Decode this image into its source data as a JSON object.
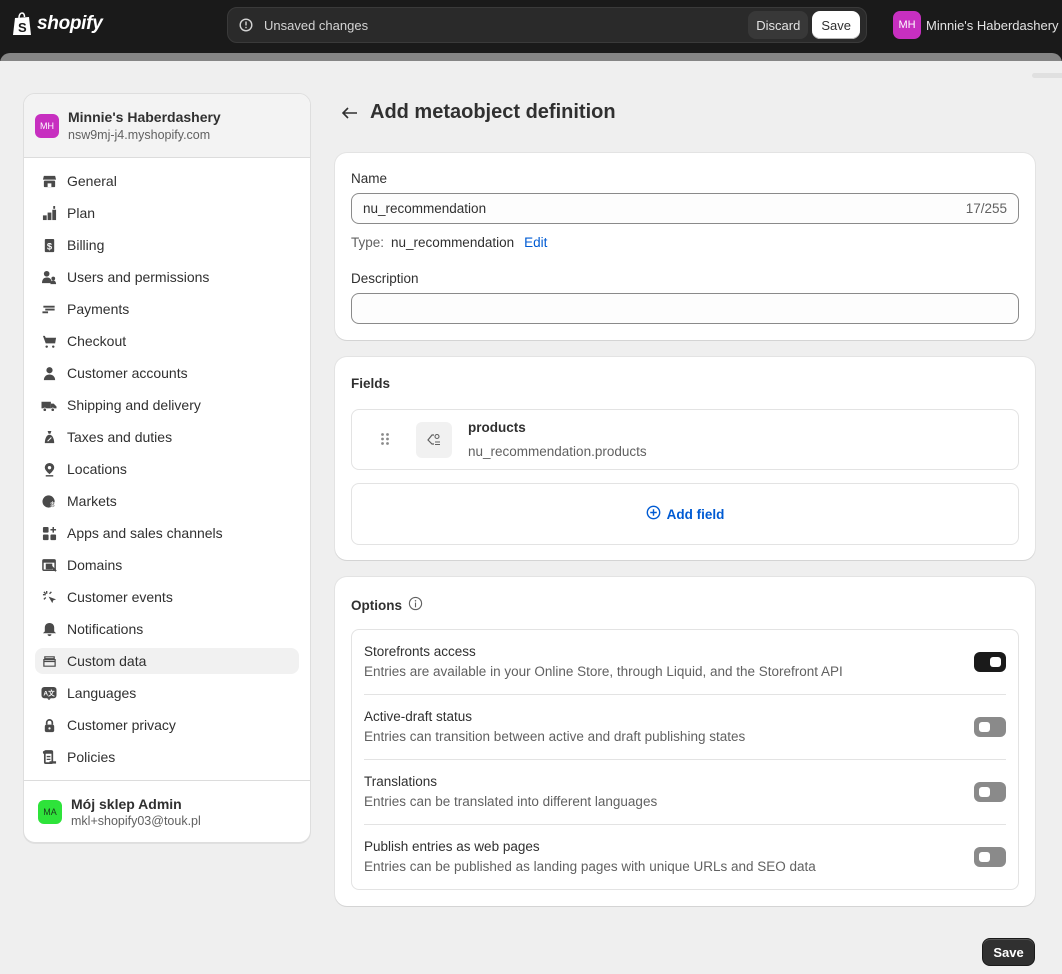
{
  "topbar": {
    "logo_text": "shopify",
    "unsaved_text": "Unsaved changes",
    "discard_label": "Discard",
    "save_label": "Save",
    "store_avatar": "MH",
    "store_name": "Minnie's Haberdashery"
  },
  "sidebar": {
    "store_avatar": "MH",
    "store_name": "Minnie's Haberdashery",
    "store_url": "nsw9mj-j4.myshopify.com",
    "items": [
      {
        "label": "General",
        "icon": "store-icon"
      },
      {
        "label": "Plan",
        "icon": "plan-icon"
      },
      {
        "label": "Billing",
        "icon": "billing-icon"
      },
      {
        "label": "Users and permissions",
        "icon": "users-icon"
      },
      {
        "label": "Payments",
        "icon": "payments-icon"
      },
      {
        "label": "Checkout",
        "icon": "cart-icon"
      },
      {
        "label": "Customer accounts",
        "icon": "person-icon"
      },
      {
        "label": "Shipping and delivery",
        "icon": "truck-icon"
      },
      {
        "label": "Taxes and duties",
        "icon": "tax-bag-icon"
      },
      {
        "label": "Locations",
        "icon": "location-pin-icon"
      },
      {
        "label": "Markets",
        "icon": "globe-icon"
      },
      {
        "label": "Apps and sales channels",
        "icon": "apps-icon"
      },
      {
        "label": "Domains",
        "icon": "domains-icon"
      },
      {
        "label": "Customer events",
        "icon": "cursor-click-icon"
      },
      {
        "label": "Notifications",
        "icon": "bell-icon"
      },
      {
        "label": "Custom data",
        "icon": "custom-data-icon",
        "active": true
      },
      {
        "label": "Languages",
        "icon": "translate-icon"
      },
      {
        "label": "Customer privacy",
        "icon": "lock-icon"
      },
      {
        "label": "Policies",
        "icon": "policies-icon"
      }
    ],
    "user": {
      "avatar": "MA",
      "name": "Mój sklep Admin",
      "email": "mkl+shopify03@touk.pl"
    }
  },
  "page": {
    "title": "Add metaobject definition",
    "name_card": {
      "name_label": "Name",
      "name_value": "nu_recommendation",
      "name_counter": "17/255",
      "type_label": "Type:",
      "type_value": "nu_recommendation",
      "edit_label": "Edit",
      "description_label": "Description",
      "description_value": ""
    },
    "fields_card": {
      "title": "Fields",
      "fields": [
        {
          "name": "products",
          "key": "nu_recommendation.products",
          "icon": "product-reference-icon"
        }
      ],
      "add_field_label": "Add field"
    },
    "options_card": {
      "title": "Options",
      "options": [
        {
          "title": "Storefronts access",
          "description": "Entries are available in your Online Store, through Liquid, and the Storefront API",
          "enabled": true
        },
        {
          "title": "Active-draft status",
          "description": "Entries can transition between active and draft publishing states",
          "enabled": false
        },
        {
          "title": "Translations",
          "description": "Entries can be translated into different languages",
          "enabled": false
        },
        {
          "title": "Publish entries as web pages",
          "description": "Entries can be published as landing pages with unique URLs and SEO data",
          "enabled": false
        }
      ]
    },
    "save_label": "Save"
  }
}
